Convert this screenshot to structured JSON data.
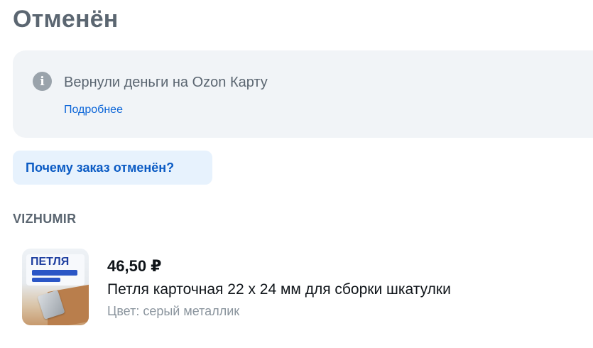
{
  "order": {
    "status_title": "Отменён"
  },
  "refund_notice": {
    "icon": "info-icon",
    "text": "Вернули деньги на Ozon Карту",
    "link_label": "Подробнее"
  },
  "why_cancelled_button": {
    "label": "Почему заказ отменён?"
  },
  "seller": {
    "name": "VIZHUMIR"
  },
  "product": {
    "price": "46,50 ₽",
    "name": "Петля карточная 22 х 24 мм для сборки шкатулки",
    "color": "Цвет: серый металлик",
    "thumbnail_label": "ПЕТЛЯ"
  },
  "colors": {
    "title": "#5b6671",
    "card_bg": "#f1f4f7",
    "link": "#0b65d8",
    "button_bg": "#e7f2fd",
    "button_text": "#0b5bc4",
    "muted": "#8a949d"
  }
}
